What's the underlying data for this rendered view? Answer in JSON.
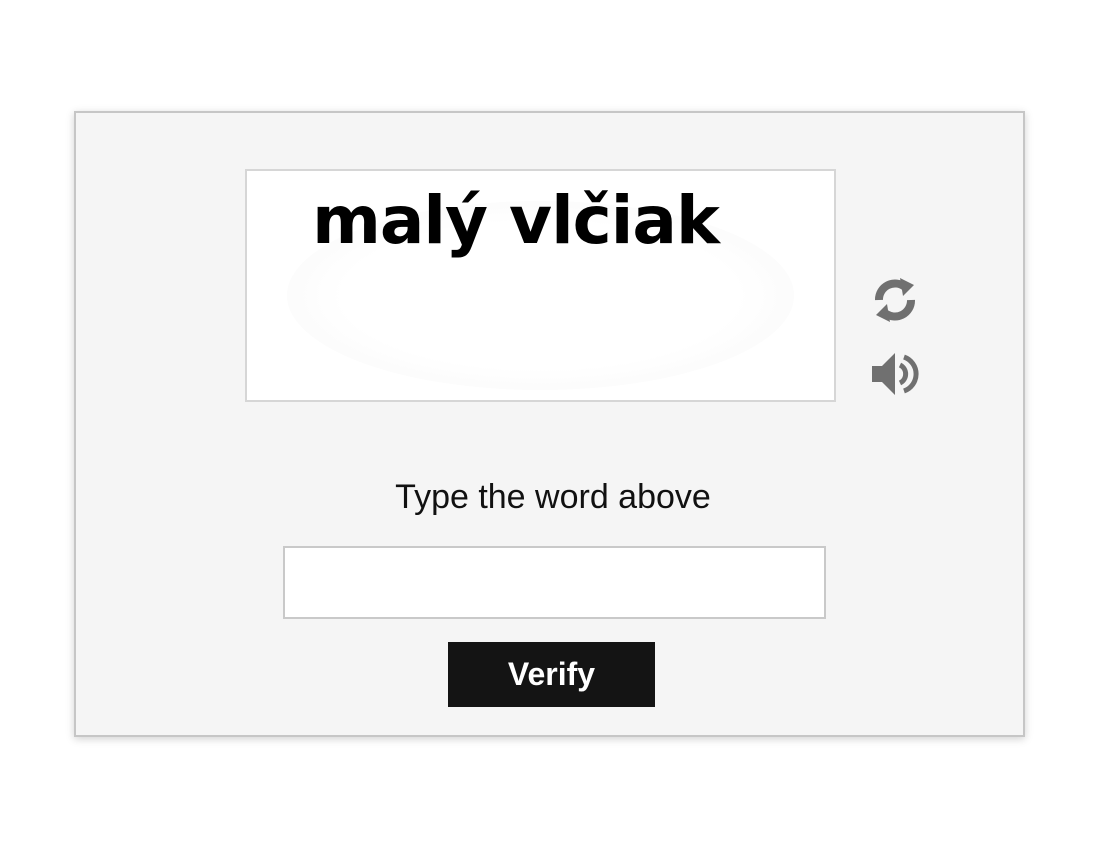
{
  "captcha": {
    "word": "malý vlčiak",
    "refresh_icon": "refresh-icon",
    "audio_icon": "speaker-icon"
  },
  "form": {
    "instruction": "Type the word above",
    "input_value": "",
    "input_placeholder": "",
    "verify_label": "Verify"
  },
  "colors": {
    "panel_bg": "#f5f5f5",
    "button_bg": "#141414",
    "icon": "#707070"
  }
}
